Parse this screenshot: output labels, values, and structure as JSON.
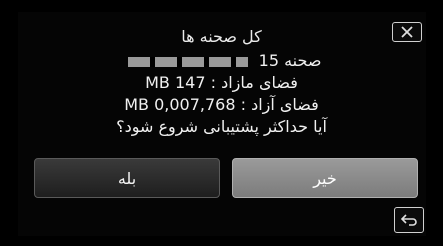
{
  "dialog": {
    "title": "کل صحنه ها",
    "selected_line_suffix": "صحنه 15",
    "free_space_label": "فضای مازاد : 147 MB",
    "added_space_label": "فضای آزاد : 0,007,768 MB",
    "question": "آیا حداکثر پشتیبانی شروع شود؟"
  },
  "buttons": {
    "yes_label": "بله",
    "no_label": "خیر"
  },
  "icons": {
    "close": "close-icon",
    "back": "back-arrow-icon"
  },
  "colors": {
    "background": "#000000",
    "primary_button": "#2a2a2a",
    "secondary_button": "#8a8a8a",
    "text": "#f0f0f0"
  }
}
